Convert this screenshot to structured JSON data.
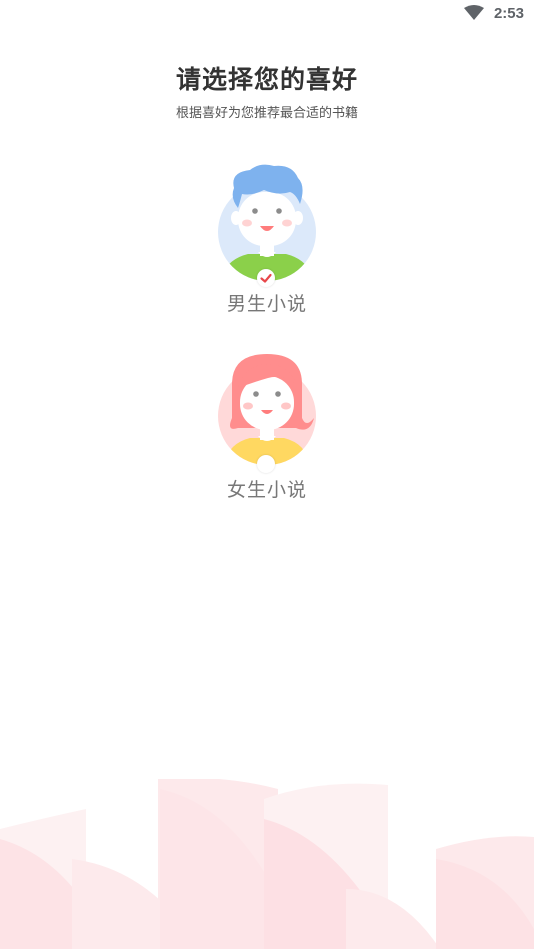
{
  "status_bar": {
    "time": "2:53",
    "wifi_icon": "wifi-icon"
  },
  "header": {
    "title": "请选择您的喜好",
    "subtitle": "根据喜好为您推荐最合适的书籍"
  },
  "options": [
    {
      "label": "男生小说",
      "selected": true,
      "icon": "boy-avatar-icon",
      "accent": "#8bd04a"
    },
    {
      "label": "女生小说",
      "selected": false,
      "icon": "girl-avatar-icon",
      "accent": "#ffd861"
    }
  ],
  "colors": {
    "check": "#e8474a",
    "male_circle": "#dce9fa",
    "male_hair": "#7eb2ee",
    "female_circle": "#ffd9d9",
    "female_hair": "#ff8d8d",
    "background_deco": "#fde6e8"
  }
}
